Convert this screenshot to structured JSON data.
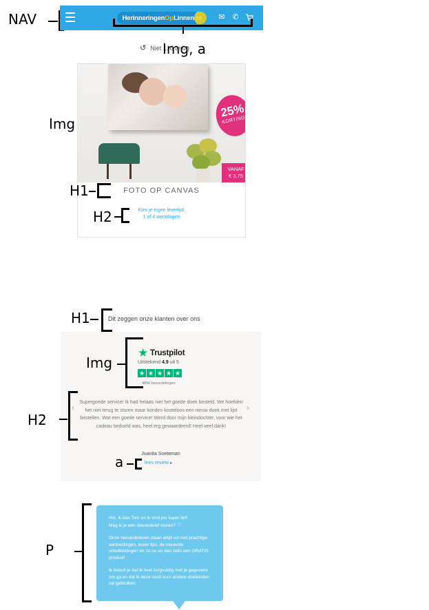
{
  "annotations": {
    "nav": "NAV",
    "img_a": "Img, a",
    "img": "Img",
    "h1_product": "H1",
    "h2_product": "H2",
    "h1_reviews": "H1",
    "img_trustpilot": "Img",
    "h2_reviews": "H2",
    "a_review": "a",
    "p_newsletter": "P"
  },
  "header": {
    "logo_text_part1": "Herinneringen",
    "logo_text_op": "Op",
    "logo_text_part2": "Linnen.nl",
    "icons": [
      "menu-icon",
      "mail-icon",
      "phone-icon",
      "cart-icon"
    ]
  },
  "recently_viewed": {
    "text": "Niet ... d terug"
  },
  "product": {
    "discount_big": "25%",
    "discount_small": "KORTING!",
    "price_prefix": "VANAF",
    "price": "€ 3,75",
    "title": "FOTO OP CANVAS",
    "delivery_line1": "Kies je eigen levertijd:",
    "delivery_line2": "1 of 4 werkdagen"
  },
  "reviews": {
    "title": "Dit zeggen onze klanten over ons",
    "trustpilot_name": "Trustpilot",
    "rating_label": "Uitstekend",
    "rating_value": "4.9",
    "rating_suffix": "uit 5",
    "review_count": "4856 beoordelingen",
    "review_text": "Supergoede service! Ik had helaas niet het goede doek besteld. We hoefden het niet terug te sturen maar konden kosteloos een nieuw doek met lijst bestellen. Wat een goede service! Werd door mijn kleindochter, voor wie het cadeau bedoeld was, heel erg gewaardeerd! Heel veel dank!",
    "reviewer_name": "Juanita Soeteman",
    "read_review": "lees review"
  },
  "newsletter": {
    "line1": "Hoi, ik ben Tom en ik vind jou super lief!",
    "line2": "Mag ik je een nieuwsbrief sturen?",
    "paragraph2": "Onze nieuwsbrieven staan altijd vol met prachtige aanbiedingen, leuke tips, de nieuwste ontwikkelingen en zo nu en dan zelfs een GRATIS product!",
    "paragraph3": "Ik beloof je dat ik heel zorgvuldig met je gegevens om ga en dat ik deze nooit voor andere doeleinden zal gebruiken."
  },
  "colors": {
    "brand_blue": "#2fa9e6",
    "accent_pink": "#e2317c",
    "trustpilot_green": "#00b67a",
    "bubble_blue": "#6fc9ee"
  }
}
